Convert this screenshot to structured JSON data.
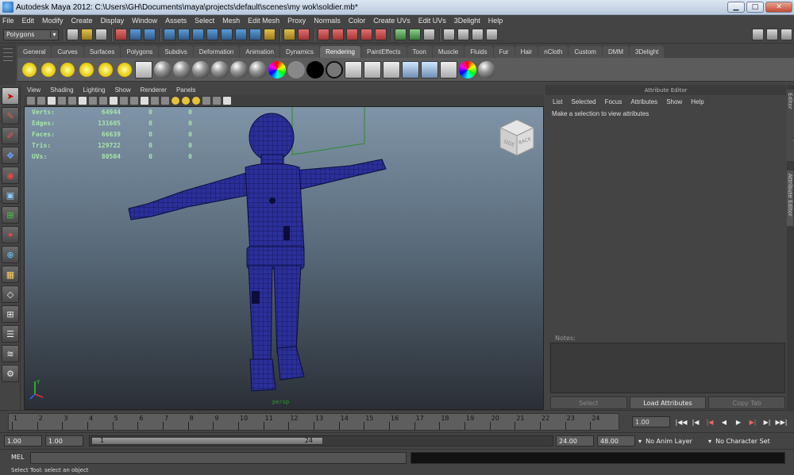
{
  "window": {
    "title": "Autodesk Maya 2012: C:\\Users\\GH\\Documents\\maya\\projects\\default\\scenes\\my wok\\soldier.mb*",
    "minimize": "▁",
    "maximize": "□",
    "close": "✕"
  },
  "menubar": [
    "File",
    "Edit",
    "Modify",
    "Create",
    "Display",
    "Window",
    "Assets",
    "Select",
    "Mesh",
    "Edit Mesh",
    "Proxy",
    "Normals",
    "Color",
    "Create UVs",
    "Edit UVs",
    "3Delight",
    "Help"
  ],
  "statusline": {
    "mode": "Polygons"
  },
  "shelf": {
    "tabs": [
      "General",
      "Curves",
      "Surfaces",
      "Polygons",
      "Subdivs",
      "Deformation",
      "Animation",
      "Dynamics",
      "Rendering",
      "PaintEffects",
      "Toon",
      "Muscle",
      "Fluids",
      "Fur",
      "Hair",
      "nCloth",
      "Custom",
      "DMM",
      "3Delight"
    ],
    "active_tab": "Rendering"
  },
  "viewport": {
    "menu": [
      "View",
      "Shading",
      "Lighting",
      "Show",
      "Renderer",
      "Panels"
    ],
    "camera": "persp",
    "hud": [
      {
        "label": "Verts:",
        "v1": "64944",
        "v2": "0",
        "v3": "0"
      },
      {
        "label": "Edges:",
        "v1": "131605",
        "v2": "0",
        "v3": "0"
      },
      {
        "label": "Faces:",
        "v1": "66639",
        "v2": "0",
        "v3": "0"
      },
      {
        "label": "Tris:",
        "v1": "129722",
        "v2": "0",
        "v3": "0"
      },
      {
        "label": "UVs:",
        "v1": "80504",
        "v2": "0",
        "v3": "0"
      }
    ],
    "viewcube": {
      "left": "SIDE",
      "front": "BACK"
    },
    "axis_label": "Y"
  },
  "attribute_editor": {
    "header": "Attribute Editor",
    "menu": [
      "List",
      "Selected",
      "Focus",
      "Attributes",
      "Show",
      "Help"
    ],
    "message": "Make a selection to view attributes",
    "notes_label": "Notes:",
    "buttons": {
      "select": "Select",
      "load": "Load Attributes",
      "copy": "Copy Tab"
    },
    "side_tabs": [
      "Channel Box / Layer Editor",
      "Attribute Editor"
    ]
  },
  "timeline": {
    "ticks": [
      "1",
      "2",
      "3",
      "4",
      "5",
      "6",
      "7",
      "8",
      "9",
      "10",
      "11",
      "12",
      "13",
      "14",
      "15",
      "16",
      "17",
      "18",
      "19",
      "20",
      "21",
      "22",
      "23",
      "24"
    ],
    "current_frame": "1.00"
  },
  "range": {
    "start": "1.00",
    "playback_start": "1.00",
    "slider_start": "1",
    "slider_end": "24",
    "playback_end": "24.00",
    "end": "48.00",
    "anim_layer": "No Anim Layer",
    "character_set": "No Character Set"
  },
  "cmdline": {
    "label": "MEL"
  },
  "helpline": {
    "text": "Select Tool: select an object"
  }
}
